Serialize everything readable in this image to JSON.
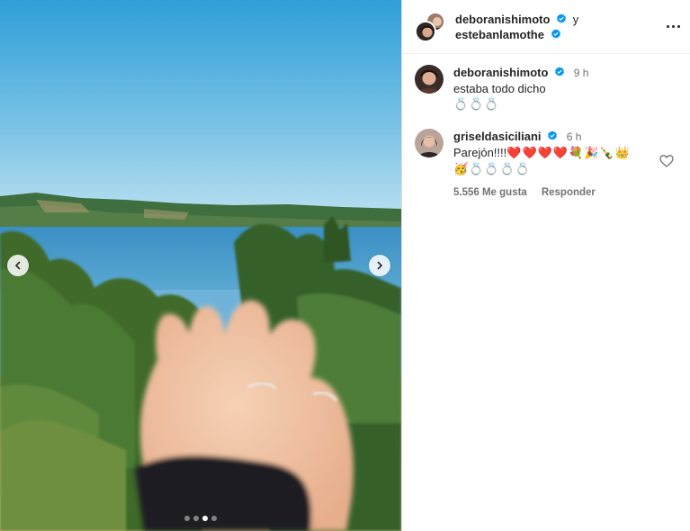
{
  "header": {
    "user1": "deboranishimoto",
    "joiner": "y",
    "user2": "estebanlamothe"
  },
  "carousel": {
    "slides_total": 4,
    "active_slide": 3
  },
  "comments": [
    {
      "username": "deboranishimoto",
      "time": "9 h",
      "text": "estaba todo dicho",
      "emojis": "💍💍💍"
    },
    {
      "username": "griseldasiciliani",
      "time": "6 h",
      "text": "Parejón!!!!",
      "emojis_line1": "❤️❤️❤️❤️💐🎉🍾👑",
      "emojis_line2": "🥳💍💍💍💍",
      "likes": "5.556 Me gusta",
      "reply": "Responder"
    }
  ],
  "colors": {
    "verified": "#0095f6",
    "text": "#262626",
    "secondary": "#737373"
  }
}
